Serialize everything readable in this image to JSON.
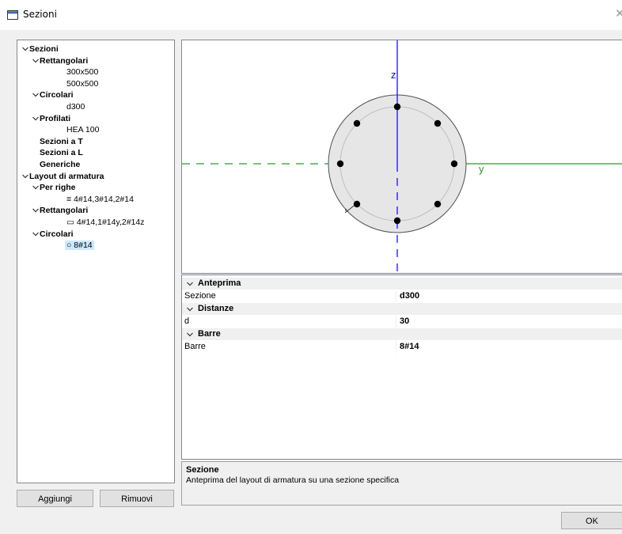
{
  "window": {
    "title": "Sezioni",
    "close_glyph": "✕"
  },
  "tree": [
    {
      "label": "Sezioni",
      "level": 0,
      "chev": true,
      "bold": true,
      "id": "sezioni"
    },
    {
      "label": "Rettangolari",
      "level": 1,
      "chev": true,
      "bold": true,
      "id": "rettangolari"
    },
    {
      "label": "300x500",
      "level": 2,
      "chev": false,
      "bold": false,
      "id": "300x500"
    },
    {
      "label": "500x500",
      "level": 2,
      "chev": false,
      "bold": false,
      "id": "500x500"
    },
    {
      "label": "Circolari",
      "level": 1,
      "chev": true,
      "bold": true,
      "id": "circolari"
    },
    {
      "label": "d300",
      "level": 2,
      "chev": false,
      "bold": false,
      "id": "d300"
    },
    {
      "label": "Profilati",
      "level": 1,
      "chev": true,
      "bold": true,
      "id": "profilati"
    },
    {
      "label": "HEA 100",
      "level": 2,
      "chev": false,
      "bold": false,
      "id": "hea-100"
    },
    {
      "label": "Sezioni a T",
      "level": 1,
      "chev": false,
      "bold": true,
      "id": "sezioni-a-t"
    },
    {
      "label": "Sezioni a L",
      "level": 1,
      "chev": false,
      "bold": true,
      "id": "sezioni-a-l"
    },
    {
      "label": "Generiche",
      "level": 1,
      "chev": false,
      "bold": true,
      "id": "generiche"
    },
    {
      "label": "Layout di armatura",
      "level": 0,
      "chev": true,
      "bold": true,
      "id": "layout-di-armatura"
    },
    {
      "label": "Per righe",
      "level": 1,
      "chev": true,
      "bold": true,
      "id": "per-righe"
    },
    {
      "label": "≡ 4#14,3#14,2#14",
      "level": 2,
      "chev": false,
      "bold": false,
      "id": "4-14-3-14-2-14"
    },
    {
      "label": "Rettangolari",
      "level": 1,
      "chev": true,
      "bold": true,
      "id": "rettangolari-layout"
    },
    {
      "label": "▭ 4#14,1#14y,2#14z",
      "level": 2,
      "chev": false,
      "bold": false,
      "id": "4-14-1-14y-2-14z"
    },
    {
      "label": "Circolari",
      "level": 1,
      "chev": true,
      "bold": true,
      "id": "circolari-layout"
    },
    {
      "label": "○ 8#14",
      "level": 2,
      "chev": false,
      "bold": false,
      "selected": true,
      "id": "8-14"
    }
  ],
  "buttons": {
    "add": "Aggiungi",
    "remove": "Rimuovi",
    "ok": "OK"
  },
  "preview": {
    "axis_z": "z",
    "axis_y": "y",
    "cover_label": "c",
    "colors": {
      "z_axis": "#0000ff",
      "y_axis": "#2a9a2a",
      "section_fill": "#e6e6e6",
      "section_stroke": "#505050",
      "bar": "#000000"
    }
  },
  "properties": {
    "categories": [
      {
        "label": "Anteprima",
        "rows": [
          {
            "name": "Sezione",
            "value": "d300"
          }
        ]
      },
      {
        "label": "Distanze",
        "rows": [
          {
            "name": "d",
            "value": "30"
          }
        ]
      },
      {
        "label": "Barre",
        "rows": [
          {
            "name": "Barre",
            "value": "8#14"
          }
        ]
      }
    ]
  },
  "description": {
    "title": "Sezione",
    "text": "Anteprima del layout di armatura su una sezione specifica"
  }
}
